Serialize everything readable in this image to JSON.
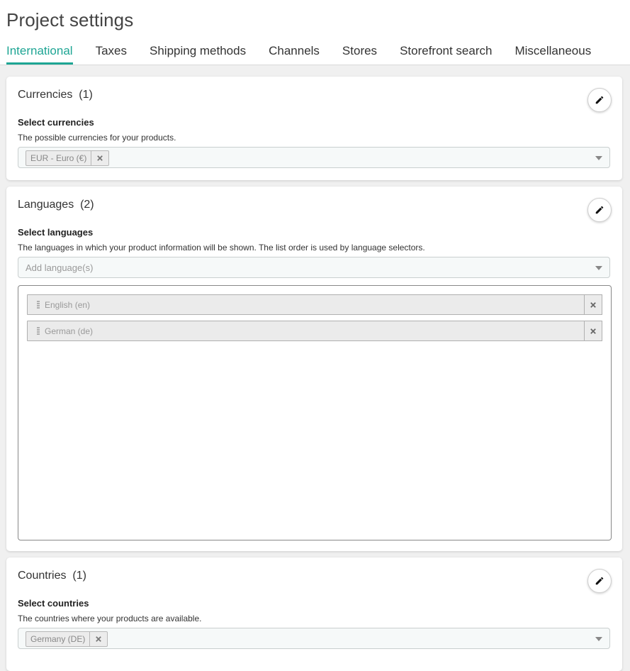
{
  "page": {
    "title": "Project settings"
  },
  "tabs": [
    {
      "label": "International",
      "active": true
    },
    {
      "label": "Taxes"
    },
    {
      "label": "Shipping methods"
    },
    {
      "label": "Channels"
    },
    {
      "label": "Stores"
    },
    {
      "label": "Storefront search"
    },
    {
      "label": "Miscellaneous"
    }
  ],
  "currencies": {
    "title": "Currencies",
    "count": "(1)",
    "field_label": "Select currencies",
    "help": "The possible currencies for your products.",
    "selected": [
      "EUR - Euro (€)"
    ]
  },
  "languages": {
    "title": "Languages",
    "count": "(2)",
    "field_label": "Select languages",
    "help": "The languages in which your product information will be shown.  The list order is used by language selectors.",
    "placeholder": "Add language(s)",
    "items": [
      "English (en)",
      "German (de)"
    ]
  },
  "countries": {
    "title": "Countries",
    "count": "(1)",
    "field_label": "Select countries",
    "help": "The countries where your products are available.",
    "selected": [
      "Germany (DE)"
    ]
  },
  "colors": {
    "accent": "#1ea594",
    "background": "#f0f0f0"
  },
  "icons": {
    "edit": "pencil-icon",
    "remove": "close-icon",
    "dropdown": "caret-down-icon",
    "drag": "drag-handle-icon"
  }
}
